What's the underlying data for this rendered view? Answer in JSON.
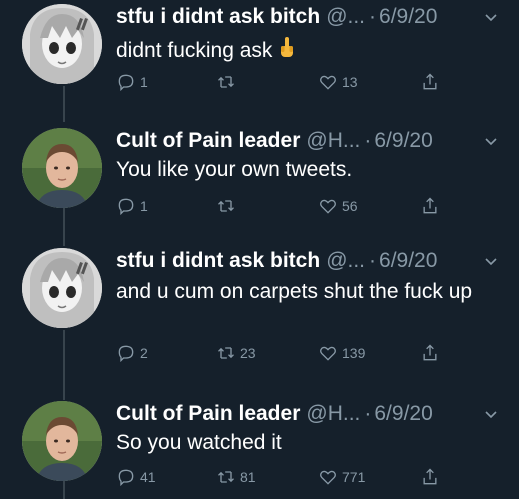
{
  "tweets": [
    {
      "name": "stfu i didnt ask bitch",
      "handle": "@...",
      "sep": "·",
      "date": "6/9/20",
      "text": "didnt fucking ask",
      "text_emoji": "middle-finger-emoji",
      "replies": "1",
      "retweets": "",
      "likes": "13",
      "avatar": "anime-avatar"
    },
    {
      "name": "Cult of Pain leader",
      "handle": "@H...",
      "sep": "·",
      "date": "6/9/20",
      "text": "You like your own tweets.",
      "replies": "1",
      "retweets": "",
      "likes": "56",
      "avatar": "photo-avatar"
    },
    {
      "name": "stfu i didnt ask bitch",
      "handle": "@...",
      "sep": "·",
      "date": "6/9/20",
      "text": "and u cum on carpets shut the fuck up",
      "replies": "2",
      "retweets": "23",
      "likes": "139",
      "avatar": "anime-avatar"
    },
    {
      "name": "Cult of Pain leader",
      "handle": "@H...",
      "sep": "·",
      "date": "6/9/20",
      "text": "So you watched it",
      "replies": "41",
      "retweets": "81",
      "likes": "771",
      "avatar": "photo-avatar"
    }
  ],
  "colors": {
    "background": "#15202b",
    "secondary_text": "#8899a6",
    "thread_line": "#38444d"
  }
}
